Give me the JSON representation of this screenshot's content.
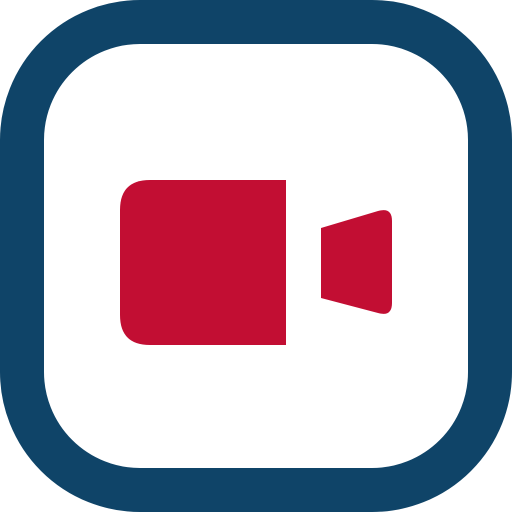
{
  "icon": {
    "name": "video-camera-icon",
    "frame_icon": "rounded-square-frame",
    "colors": {
      "frame": "#0f4468",
      "camera": "#c20e33",
      "background": "#ffffff"
    }
  }
}
